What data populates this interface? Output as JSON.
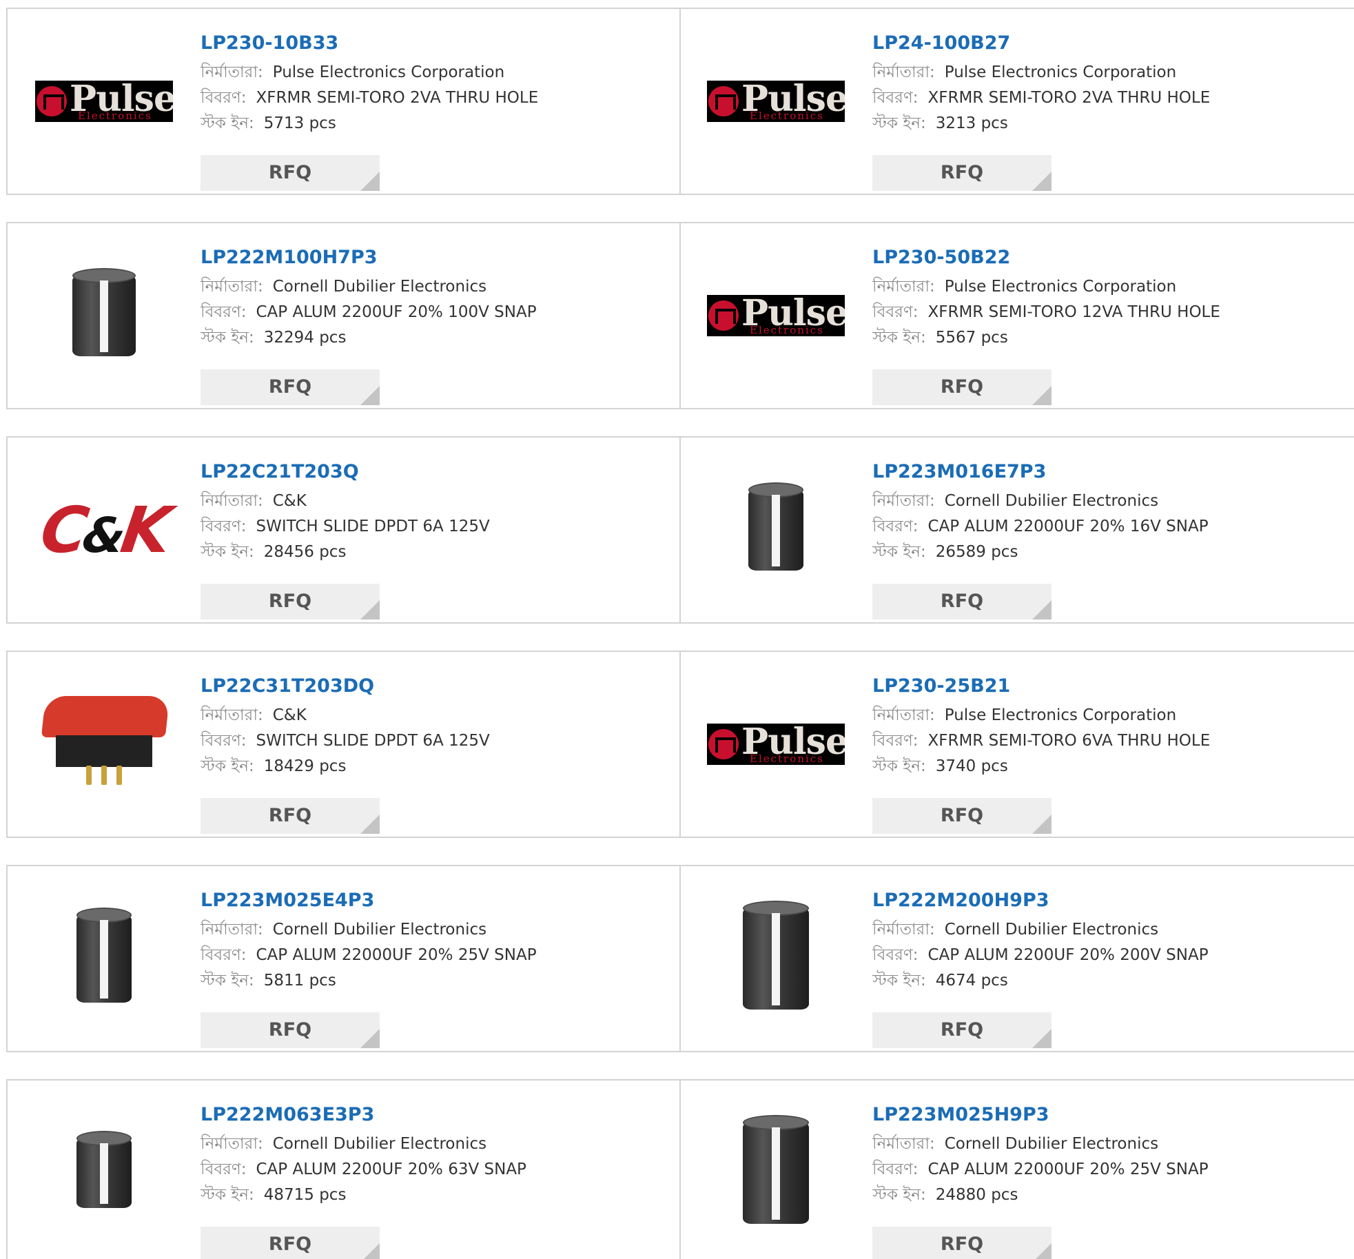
{
  "labels": {
    "manufacturer": "নির্মাতারা:",
    "description": "বিবরণ:",
    "stock": "স্টক ইন:",
    "rfq": "RFQ"
  },
  "products": [
    {
      "part": "LP230-10B33",
      "manufacturer": "Pulse Electronics Corporation",
      "description": "XFRMR SEMI-TORO 2VA THRU HOLE",
      "stock": "5713 pcs",
      "image": "pulse-logo"
    },
    {
      "part": "LP24-100B27",
      "manufacturer": "Pulse Electronics Corporation",
      "description": "XFRMR SEMI-TORO 2VA THRU HOLE",
      "stock": "3213 pcs",
      "image": "pulse-logo"
    },
    {
      "part": "LP222M100H7P3",
      "manufacturer": "Cornell Dubilier Electronics",
      "description": "CAP ALUM 2200UF 20% 100V SNAP",
      "stock": "32294 pcs",
      "image": "capacitor"
    },
    {
      "part": "LP230-50B22",
      "manufacturer": "Pulse Electronics Corporation",
      "description": "XFRMR SEMI-TORO 12VA THRU HOLE",
      "stock": "5567 pcs",
      "image": "pulse-logo"
    },
    {
      "part": "LP22C21T203Q",
      "manufacturer": "C&K",
      "description": "SWITCH SLIDE DPDT 6A 125V",
      "stock": "28456 pcs",
      "image": "ck-logo"
    },
    {
      "part": "LP223M016E7P3",
      "manufacturer": "Cornell Dubilier Electronics",
      "description": "CAP ALUM 22000UF 20% 16V SNAP",
      "stock": "26589 pcs",
      "image": "capacitor"
    },
    {
      "part": "LP22C31T203DQ",
      "manufacturer": "C&K",
      "description": "SWITCH SLIDE DPDT 6A 125V",
      "stock": "18429 pcs",
      "image": "switch"
    },
    {
      "part": "LP230-25B21",
      "manufacturer": "Pulse Electronics Corporation",
      "description": "XFRMR SEMI-TORO 6VA THRU HOLE",
      "stock": "3740 pcs",
      "image": "pulse-logo"
    },
    {
      "part": "LP223M025E4P3",
      "manufacturer": "Cornell Dubilier Electronics",
      "description": "CAP ALUM 22000UF 20% 25V SNAP",
      "stock": "5811 pcs",
      "image": "capacitor"
    },
    {
      "part": "LP222M200H9P3",
      "manufacturer": "Cornell Dubilier Electronics",
      "description": "CAP ALUM 2200UF 20% 200V SNAP",
      "stock": "4674 pcs",
      "image": "capacitor"
    },
    {
      "part": "LP222M063E3P3",
      "manufacturer": "Cornell Dubilier Electronics",
      "description": "CAP ALUM 2200UF 20% 63V SNAP",
      "stock": "48715 pcs",
      "image": "capacitor"
    },
    {
      "part": "LP223M025H9P3",
      "manufacturer": "Cornell Dubilier Electronics",
      "description": "CAP ALUM 22000UF 20% 25V SNAP",
      "stock": "24880 pcs",
      "image": "capacitor"
    }
  ],
  "logos": {
    "pulse_word": "Pulse",
    "pulse_sub": "Electronics",
    "ck_c": "C",
    "ck_amp": "&",
    "ck_k": "K"
  },
  "colors": {
    "part_link": "#1b6cb6",
    "label_gray": "#8a8a8a",
    "rfq_bg": "#eeeeee",
    "border": "#d3d3d3"
  }
}
